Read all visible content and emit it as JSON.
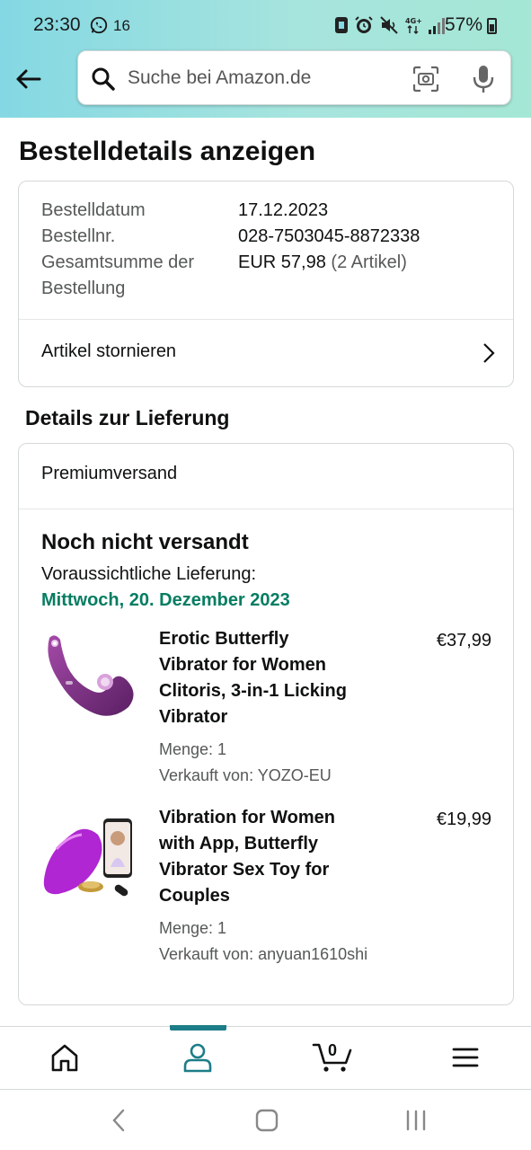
{
  "status_bar": {
    "time": "23:30",
    "notification_count": "16",
    "battery": "57%"
  },
  "search": {
    "placeholder": "Suche bei Amazon.de"
  },
  "page": {
    "title": "Bestelldetails anzeigen"
  },
  "order_summary": {
    "date_label": "Bestelldatum",
    "date_value": "17.12.2023",
    "number_label": "Bestellnr.",
    "number_value": "028-7503045-8872338",
    "total_label_1": "Gesamtsumme der",
    "total_label_2": "Bestellung",
    "total_value": "EUR 57,98",
    "total_items": "(2 Artikel)",
    "cancel_label": "Artikel stornieren"
  },
  "delivery": {
    "section_title": "Details zur Lieferung",
    "shipping_method": "Premiumversand",
    "status": "Noch nicht versandt",
    "eta_label": "Voraussichtliche Lieferung:",
    "eta_date": "Mittwoch, 20. Dezember 2023",
    "eta_color": "#067d62",
    "items": [
      {
        "title_lines": [
          "Erotic Butterfly",
          "Vibrator for Women",
          "Clitoris, 3-in-1 Licking",
          "Vibrator"
        ],
        "price": "€37,99",
        "quantity": "Menge: 1",
        "seller": "Verkauft von: YOZO-EU"
      },
      {
        "title_lines": [
          "Vibration for Women",
          "with App, Butterfly",
          "Vibrator Sex Toy for",
          "Couples"
        ],
        "price": "€19,99",
        "quantity": "Menge: 1",
        "seller": "Verkauft von: anyuan1610shi"
      }
    ]
  },
  "bottom_nav": {
    "active_tab": "account",
    "cart_count": "0",
    "accent_color": "#1c7d88"
  }
}
